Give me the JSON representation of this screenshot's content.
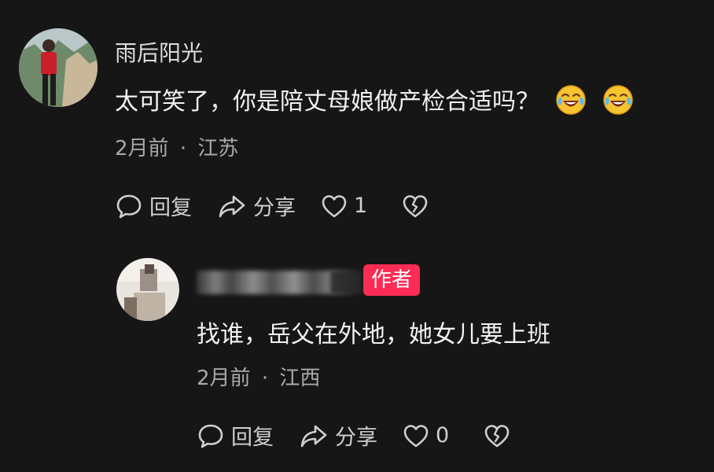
{
  "comments": [
    {
      "username": "雨后阳光",
      "text": "太可笑了，你是陪丈母娘做产检合适吗？",
      "emojis": [
        "laugh-cry-emoji",
        "laugh-cry-emoji"
      ],
      "time": "2月前",
      "separator": "·",
      "location": "江苏",
      "reply_label": "回复",
      "share_label": "分享",
      "like_count": "1"
    },
    {
      "username_blurred": true,
      "badge": "作者",
      "text": "找谁，岳父在外地，她女儿要上班",
      "time": "2月前",
      "separator": "·",
      "location": "江西",
      "reply_label": "回复",
      "share_label": "分享",
      "like_count": "0"
    }
  ],
  "colors": {
    "background": "#161616",
    "author_badge": "#fe2c55",
    "emoji_face": "#f6c431"
  }
}
